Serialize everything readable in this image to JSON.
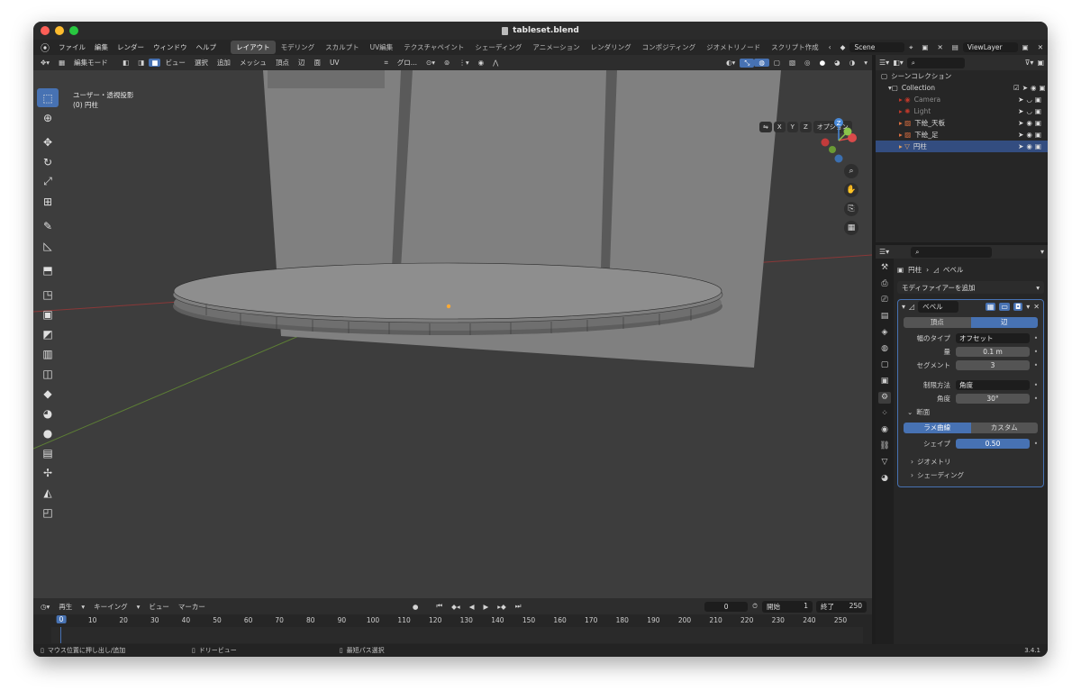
{
  "window": {
    "title": "tableset.blend"
  },
  "menu": [
    "ファイル",
    "編集",
    "レンダー",
    "ウィンドウ",
    "ヘルプ"
  ],
  "workspaces": [
    "レイアウト",
    "モデリング",
    "スカルプト",
    "UV編集",
    "テクスチャペイント",
    "シェーディング",
    "アニメーション",
    "レンダリング",
    "コンポジティング",
    "ジオメトリノード",
    "スクリプト作成"
  ],
  "scene": {
    "name": "Scene",
    "view_layer": "ViewLayer"
  },
  "viewport_header": {
    "mode": "編集モード",
    "menus": [
      "ビュー",
      "選択",
      "追加",
      "メッシュ",
      "頂点",
      "辺",
      "面",
      "UV"
    ],
    "transform": "グロ...",
    "options": "オプション"
  },
  "axes": {
    "x": "X",
    "y": "Y",
    "z": "Z"
  },
  "viewport": {
    "projection": "ユーザー・透視投影",
    "object": "(0) 円柱"
  },
  "outliner": {
    "root": "シーンコレクション",
    "collection": "Collection",
    "items": [
      {
        "name": "Camera",
        "dim": true
      },
      {
        "name": "Light",
        "dim": true
      },
      {
        "name": "下絵_天板",
        "dim": false
      },
      {
        "name": "下絵_足",
        "dim": false
      },
      {
        "name": "円柱",
        "dim": false,
        "selected": true
      }
    ]
  },
  "properties": {
    "breadcrumb_object": "円柱",
    "breadcrumb_modifier": "ベベル",
    "add_modifier": "モディファイアーを追加",
    "modifier_name": "ベベル",
    "affect": {
      "vertex": "頂点",
      "edge": "辺",
      "active": "edge"
    },
    "width_type": {
      "label": "幅のタイプ",
      "value": "オフセット"
    },
    "amount": {
      "label": "量",
      "value": "0.1 m"
    },
    "segments": {
      "label": "セグメント",
      "value": "3"
    },
    "limit_method": {
      "label": "制限方法",
      "value": "角度"
    },
    "angle": {
      "label": "角度",
      "value": "30°"
    },
    "profile_section": "断面",
    "profile_type": {
      "superellipse": "ラメ曲線",
      "custom": "カスタム",
      "active": "superellipse"
    },
    "shape": {
      "label": "シェイプ",
      "value": "0.50",
      "fraction": 0.5
    },
    "geometry_section": "ジオメトリ",
    "shading_section": "シェーディング"
  },
  "timeline": {
    "menus": [
      "再生",
      "キーイング",
      "ビュー",
      "マーカー"
    ],
    "current_frame": "0",
    "start_label": "開始",
    "start": "1",
    "end_label": "終了",
    "end": "250",
    "ticks": [
      "0",
      "10",
      "20",
      "30",
      "40",
      "50",
      "60",
      "70",
      "80",
      "90",
      "100",
      "110",
      "120",
      "130",
      "140",
      "150",
      "160",
      "170",
      "180",
      "190",
      "200",
      "210",
      "220",
      "230",
      "240",
      "250"
    ]
  },
  "status": {
    "hint1": "マウス位置に押し出し/追加",
    "hint2": "ドリービュー",
    "hint3": "最短パス選択",
    "version": "3.4.1"
  },
  "colors": {
    "accent": "#4772b3",
    "selection": "#334d80",
    "x_axis": "#d94a4a",
    "y_axis": "#8bc34a",
    "z_axis": "#4a8ad9"
  }
}
